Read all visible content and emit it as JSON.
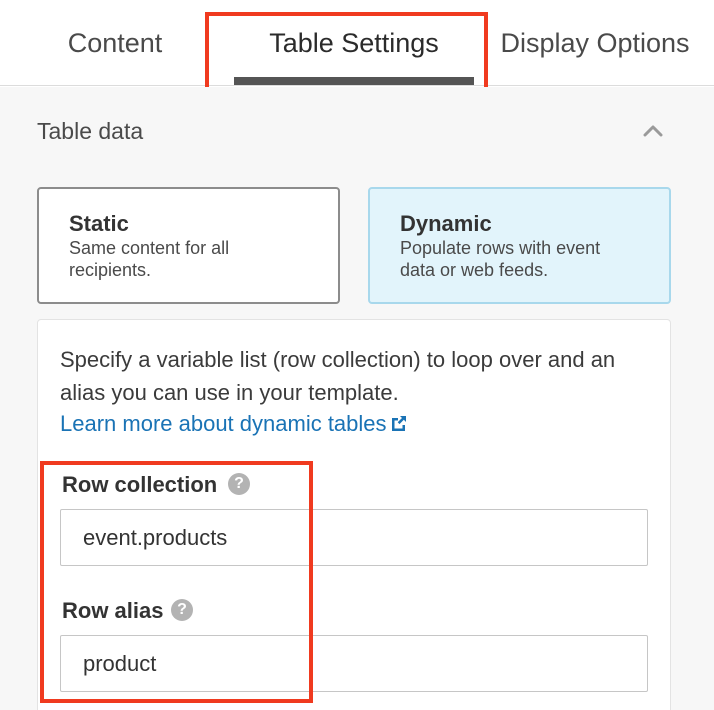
{
  "tabs": [
    {
      "label": "Content"
    },
    {
      "label": "Table Settings",
      "active": true
    },
    {
      "label": "Display Options"
    }
  ],
  "section": {
    "title": "Table data",
    "collapse_icon": "chevron-up-icon"
  },
  "modes": {
    "static": {
      "title": "Static",
      "description": "Same content for all recipients."
    },
    "dynamic": {
      "title": "Dynamic",
      "description": "Populate rows with event data or web feeds.",
      "selected": true
    }
  },
  "details": {
    "intro": "Specify a variable list (row collection) to loop over and an alias you can use in your template.",
    "link_text": "Learn more about dynamic tables",
    "link_icon": "external-link-icon"
  },
  "fields": {
    "row_collection": {
      "label": "Row collection",
      "help_icon": "help-icon",
      "help_glyph": "?",
      "value": "event.products"
    },
    "row_alias": {
      "label": "Row alias",
      "help_icon": "help-icon",
      "help_glyph": "?",
      "value": "product"
    }
  },
  "colors": {
    "highlight": "#f03a1f",
    "link": "#1a73b5",
    "selected_card_bg": "#e2f4fb",
    "selected_card_border": "#a8d8ec"
  }
}
